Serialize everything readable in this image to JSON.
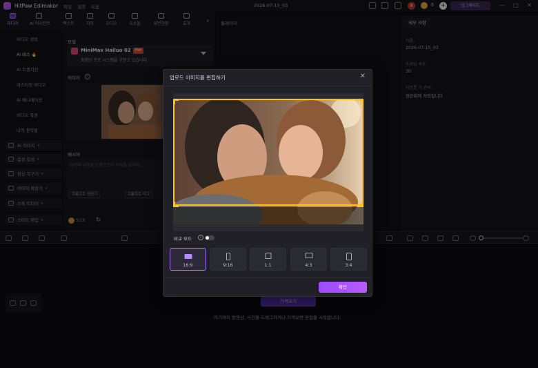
{
  "app": {
    "name": "HitPaw Edimakor",
    "menus": [
      "파일",
      "설정",
      "도움"
    ],
    "project_name": "2026-07-15_03",
    "coin_count": "0",
    "upgrade_label": "업그레이드",
    "user_badge": "X"
  },
  "toolbar": {
    "tools": [
      "미디어",
      "AI 어시턴트",
      "텍스트",
      "자막",
      "오디오",
      "요소들",
      "화면전환",
      "효과"
    ]
  },
  "sidebar": {
    "items": [
      "비디오 생성",
      "AI 비스",
      "AI 트랜지션",
      "러스터링 비디오",
      "AI 애니메이션",
      "비디오 복원",
      "나의 창작물"
    ],
    "groups": [
      "AI 이미지",
      "음성 합성",
      "영상 복구기",
      "이미지 확장기",
      "스톡 미디어",
      "스마트 편집"
    ]
  },
  "generator": {
    "model_label": "모델",
    "model_name": "MiniMax Hailuo 02",
    "hot_badge": "Hot",
    "model_desc": "최첨단 프로 시스템을 구현고 있습니다.",
    "image_label": "이미지",
    "prompt_label": "메시어",
    "prompt_placeholder": "입력해 사용할 프롬프트와 의지를 묘사하…",
    "prompt_buttons": [
      "프롬프트 생성기",
      "프롬프트 미고"
    ],
    "credits": "5/10"
  },
  "player": {
    "title": "플레이어"
  },
  "properties": {
    "tab": "세부 사항",
    "fields": [
      {
        "label": "이름:",
        "value": "2026-07-15_03"
      },
      {
        "label": "프레임 속도:",
        "value": "30"
      },
      {
        "label": "아웃풋 기 관리:",
        "value": "원본화에 저장합니다"
      }
    ]
  },
  "timeline": {
    "import_label": "가져오기",
    "drop_hint": "여기까지 동영상, 사진을 드래그하거나 가져오면 편집을 시작합니다."
  },
  "modal": {
    "title": "업로드 이미지를 편집하기",
    "compare_label": "비교 모드",
    "ratios": [
      "16:9",
      "9:16",
      "1:1",
      "4:3",
      "3:4"
    ],
    "selected_ratio": "16:9",
    "confirm_label": "확인"
  },
  "colors": {
    "accent": "#9b4dff",
    "crop": "#ffc21a",
    "hot": "#d24a2b"
  }
}
